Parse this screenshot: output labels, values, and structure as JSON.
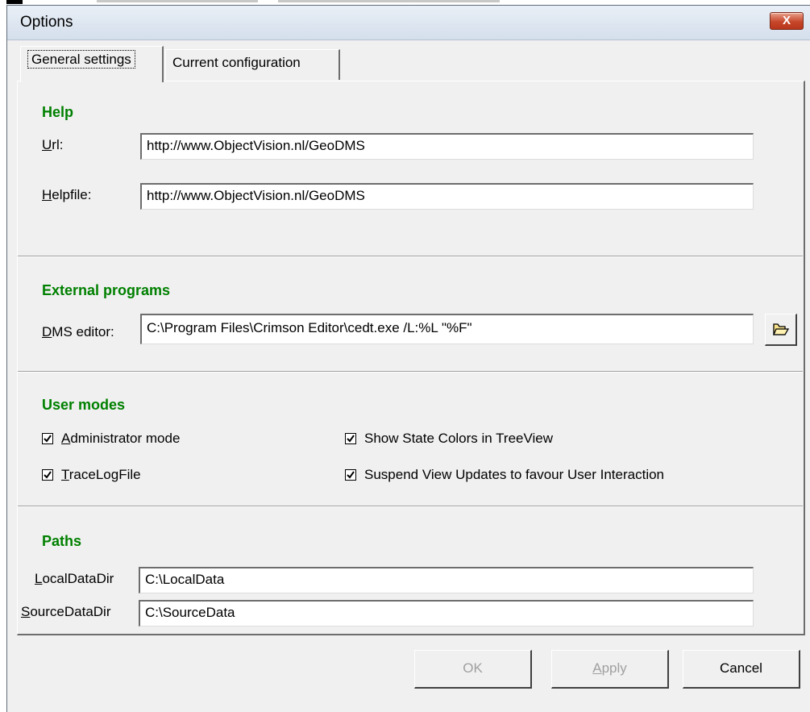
{
  "window": {
    "title": "Options",
    "close_label": "X"
  },
  "tabs": [
    {
      "label": "General settings",
      "active": true
    },
    {
      "label": "Current configuration",
      "active": false
    }
  ],
  "help": {
    "heading": "Help",
    "url_label_key": "U",
    "url_label_rest": "rl:",
    "url_value": "http://www.ObjectVision.nl/GeoDMS",
    "helpfile_label_key": "H",
    "helpfile_label_rest": "elpfile:",
    "helpfile_value": "http://www.ObjectVision.nl/GeoDMS"
  },
  "external": {
    "heading": "External programs",
    "editor_label_key": "D",
    "editor_label_rest": "MS editor:",
    "editor_value": "C:\\Program Files\\Crimson Editor\\cedt.exe /L:%L \"%F\"",
    "browse_icon": "folder-open-icon"
  },
  "user_modes": {
    "heading": "User modes",
    "options": [
      {
        "key": "A",
        "rest": "dministrator mode",
        "checked": true
      },
      {
        "key": "T",
        "rest": "raceLogFile",
        "checked": true
      },
      {
        "key": "",
        "rest": "Show State Colors in TreeView",
        "checked": true
      },
      {
        "key": "",
        "rest": "Suspend View Updates to favour User Interaction",
        "checked": true
      }
    ]
  },
  "paths": {
    "heading": "Paths",
    "local_label_key": "L",
    "local_label_rest": "ocalDataDir",
    "local_value": "C:\\LocalData",
    "source_label_key": "S",
    "source_label_rest": "ourceDataDir",
    "source_value": "C:\\SourceData"
  },
  "buttons": {
    "ok": "OK",
    "apply_key": "A",
    "apply_rest": "pply",
    "cancel": "Cancel",
    "ok_enabled": false,
    "apply_enabled": false
  },
  "colors": {
    "heading": "#008000",
    "dialog_bg": "#f0f0f0",
    "close_button": "#c7472b"
  }
}
